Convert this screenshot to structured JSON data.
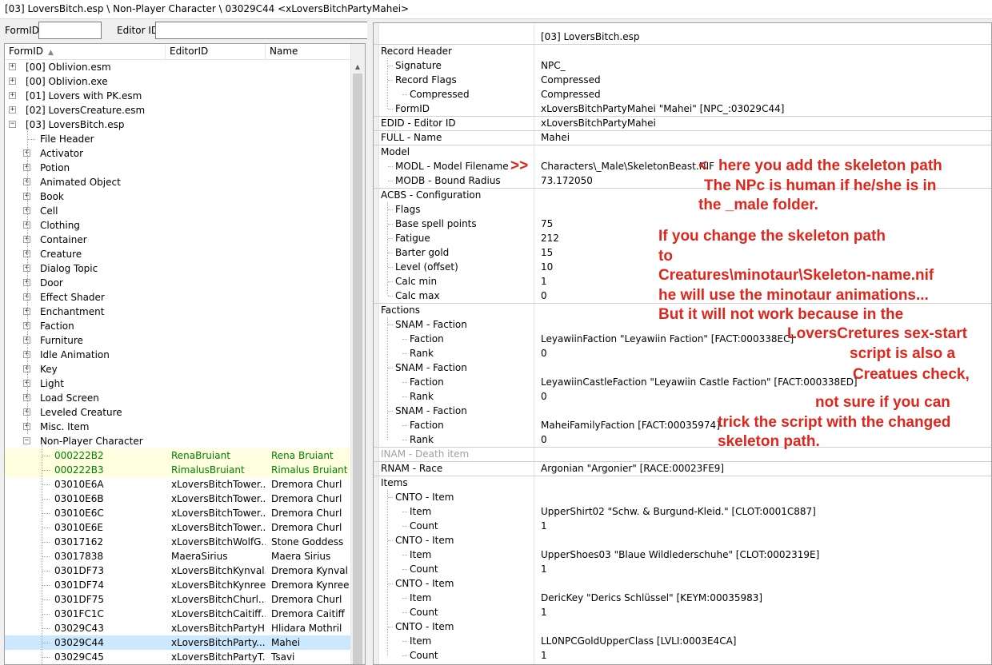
{
  "window_title": "[03] LoversBitch.esp \\ Non-Player Character \\ 03029C44 <xLoversBitchPartyMahei>",
  "search": {
    "formid_label": "FormID",
    "editorid_label": "Editor ID",
    "formid_value": "",
    "editorid_value": ""
  },
  "tree_columns": [
    "FormID",
    "EditorID",
    "Name"
  ],
  "tree": [
    {
      "label": "[00] Oblivion.esm",
      "exp": "+"
    },
    {
      "label": "[00] Oblivion.exe",
      "exp": "+"
    },
    {
      "label": "[01] Lovers with PK.esm",
      "exp": "+"
    },
    {
      "label": "[02] LoversCreature.esm",
      "exp": "+"
    },
    {
      "label": "[03] LoversBitch.esp",
      "exp": "-"
    },
    {
      "label": "File Header"
    },
    {
      "label": "Activator",
      "exp": "+"
    },
    {
      "label": "Potion",
      "exp": "+"
    },
    {
      "label": "Animated Object",
      "exp": "+"
    },
    {
      "label": "Book",
      "exp": "+"
    },
    {
      "label": "Cell",
      "exp": "+"
    },
    {
      "label": "Clothing",
      "exp": "+"
    },
    {
      "label": "Container",
      "exp": "+"
    },
    {
      "label": "Creature",
      "exp": "+"
    },
    {
      "label": "Dialog Topic",
      "exp": "+"
    },
    {
      "label": "Door",
      "exp": "+"
    },
    {
      "label": "Effect Shader",
      "exp": "+"
    },
    {
      "label": "Enchantment",
      "exp": "+"
    },
    {
      "label": "Faction",
      "exp": "+"
    },
    {
      "label": "Furniture",
      "exp": "+"
    },
    {
      "label": "Idle Animation",
      "exp": "+"
    },
    {
      "label": "Key",
      "exp": "+"
    },
    {
      "label": "Light",
      "exp": "+"
    },
    {
      "label": "Load Screen",
      "exp": "+"
    },
    {
      "label": "Leveled Creature",
      "exp": "+"
    },
    {
      "label": "Misc. Item",
      "exp": "+"
    },
    {
      "label": "Non-Player Character",
      "exp": "-"
    },
    {
      "label": "000222B2",
      "editor": "RenaBruiant",
      "name": "Rena Bruiant",
      "style": "green"
    },
    {
      "label": "000222B3",
      "editor": "RimalusBruiant",
      "name": "Rimalus Bruiant",
      "style": "green"
    },
    {
      "label": "03010E6A",
      "editor": "xLoversBitchTower...",
      "name": "Dremora Churl"
    },
    {
      "label": "03010E6B",
      "editor": "xLoversBitchTower...",
      "name": "Dremora Churl"
    },
    {
      "label": "03010E6C",
      "editor": "xLoversBitchTower...",
      "name": "Dremora Churl"
    },
    {
      "label": "03010E6E",
      "editor": "xLoversBitchTower...",
      "name": "Dremora Churl"
    },
    {
      "label": "03017162",
      "editor": "xLoversBitchWolfG...",
      "name": "Stone Goddess"
    },
    {
      "label": "03017838",
      "editor": "MaeraSirius",
      "name": "Maera Sirius"
    },
    {
      "label": "0301DF73",
      "editor": "xLoversBitchKynval...",
      "name": "Dremora Kynval"
    },
    {
      "label": "0301DF74",
      "editor": "xLoversBitchKynree...",
      "name": "Dremora Kynree..."
    },
    {
      "label": "0301DF75",
      "editor": "xLoversBitchChurl...",
      "name": "Dremora Churl"
    },
    {
      "label": "0301FC1C",
      "editor": "xLoversBitchCaitiff...",
      "name": "Dremora Caitiff"
    },
    {
      "label": "03029C43",
      "editor": "xLoversBitchPartyH...",
      "name": "Hlidara Mothril"
    },
    {
      "label": "03029C44",
      "editor": "xLoversBitchParty...",
      "name": "Mahei",
      "style": "sel"
    },
    {
      "label": "03029C45",
      "editor": "xLoversBitchPartyT...",
      "name": "Tsavi"
    }
  ],
  "details": [
    {
      "k": "",
      "v": "[03] LoversBitch.esp",
      "sep": true
    },
    {
      "k": "Record Header",
      "v": ""
    },
    {
      "k": "Signature",
      "v": "NPC_"
    },
    {
      "k": "Record Flags",
      "v": "Compressed"
    },
    {
      "k": "Compressed",
      "v": "Compressed"
    },
    {
      "k": "FormID",
      "v": "xLoversBitchPartyMahei \"Mahei\" [NPC_:03029C44]",
      "sep": true
    },
    {
      "k": "EDID - Editor ID",
      "v": "xLoversBitchPartyMahei",
      "sep": true
    },
    {
      "k": "FULL - Name",
      "v": "Mahei",
      "sep": true
    },
    {
      "k": "Model",
      "v": ""
    },
    {
      "k": "MODL - Model Filename",
      "v": "Characters\\_Male\\SkeletonBeast.NIF"
    },
    {
      "k": "MODB - Bound Radius",
      "v": "73.172050",
      "sep": true
    },
    {
      "k": "ACBS - Configuration",
      "v": ""
    },
    {
      "k": "Flags",
      "v": ""
    },
    {
      "k": "Base spell points",
      "v": "75"
    },
    {
      "k": "Fatigue",
      "v": "212"
    },
    {
      "k": "Barter gold",
      "v": "15"
    },
    {
      "k": "Level (offset)",
      "v": "10"
    },
    {
      "k": "Calc min",
      "v": "1"
    },
    {
      "k": "Calc max",
      "v": "0",
      "sep": true
    },
    {
      "k": "Factions",
      "v": ""
    },
    {
      "k": "SNAM - Faction",
      "v": ""
    },
    {
      "k": "Faction",
      "v": "LeyawiinFaction \"Leyawiin Faction\" [FACT:000338EC]"
    },
    {
      "k": "Rank",
      "v": "0"
    },
    {
      "k": "SNAM - Faction",
      "v": ""
    },
    {
      "k": "Faction",
      "v": "LeyawiinCastleFaction \"Leyawiin Castle Faction\" [FACT:000338ED]"
    },
    {
      "k": "Rank",
      "v": "0"
    },
    {
      "k": "SNAM - Faction",
      "v": ""
    },
    {
      "k": "Faction",
      "v": "MaheiFamilyFaction [FACT:00035974]"
    },
    {
      "k": "Rank",
      "v": "0",
      "sep": true
    },
    {
      "k": "INAM - Death item",
      "v": "",
      "sep": true,
      "dim": true
    },
    {
      "k": "RNAM - Race",
      "v": "Argonian \"Argonier\" [RACE:00023FE9]",
      "sep": true
    },
    {
      "k": "Items",
      "v": ""
    },
    {
      "k": "CNTO - Item",
      "v": ""
    },
    {
      "k": "Item",
      "v": "UpperShirt02 \"Schw. & Burgund-Kleid.\" [CLOT:0001C887]"
    },
    {
      "k": "Count",
      "v": "1"
    },
    {
      "k": "CNTO - Item",
      "v": ""
    },
    {
      "k": "Item",
      "v": "UpperShoes03 \"Blaue Wildlederschuhe\" [CLOT:0002319E]"
    },
    {
      "k": "Count",
      "v": "1"
    },
    {
      "k": "CNTO - Item",
      "v": ""
    },
    {
      "k": "Item",
      "v": "DericKey \"Derics Schlüssel\" [KEYM:00035983]"
    },
    {
      "k": "Count",
      "v": "1"
    },
    {
      "k": "CNTO - Item",
      "v": ""
    },
    {
      "k": "Item",
      "v": "LL0NPCGoldUpperClass [LVLI:0003E4CA]"
    },
    {
      "k": "Count",
      "v": "1"
    }
  ],
  "annotations": {
    "arrow_marker": ">>",
    "left_bracket": "<",
    "lines": [
      "here you add the skeleton path",
      "The NPc is human if he/she is  in",
      "the _male folder.",
      "If you change the skeleton path",
      "to",
      "Creatures\\minotaur\\Skeleton-name.nif",
      "he will use the minotaur animations...",
      "But it will not work because in the",
      "LoversCretures sex-start",
      "script is also a",
      "Creatues check,",
      "not sure if you can",
      "trick the script with the changed",
      "skeleton path."
    ]
  },
  "colors": {
    "annotation": "#e0251b",
    "green_text": "#008000",
    "selection": "#cce8ff",
    "highlight": "#ffffe0"
  }
}
